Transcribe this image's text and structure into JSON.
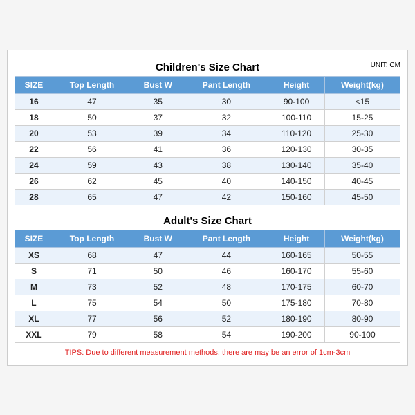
{
  "children_title": "Children's Size Chart",
  "adult_title": "Adult's Size Chart",
  "unit": "UNIT: CM",
  "headers": [
    "SIZE",
    "Top Length",
    "Bust W",
    "Pant Length",
    "Height",
    "Weight(kg)"
  ],
  "children_rows": [
    [
      "16",
      "47",
      "35",
      "30",
      "90-100",
      "<15"
    ],
    [
      "18",
      "50",
      "37",
      "32",
      "100-110",
      "15-25"
    ],
    [
      "20",
      "53",
      "39",
      "34",
      "110-120",
      "25-30"
    ],
    [
      "22",
      "56",
      "41",
      "36",
      "120-130",
      "30-35"
    ],
    [
      "24",
      "59",
      "43",
      "38",
      "130-140",
      "35-40"
    ],
    [
      "26",
      "62",
      "45",
      "40",
      "140-150",
      "40-45"
    ],
    [
      "28",
      "65",
      "47",
      "42",
      "150-160",
      "45-50"
    ]
  ],
  "adult_rows": [
    [
      "XS",
      "68",
      "47",
      "44",
      "160-165",
      "50-55"
    ],
    [
      "S",
      "71",
      "50",
      "46",
      "160-170",
      "55-60"
    ],
    [
      "M",
      "73",
      "52",
      "48",
      "170-175",
      "60-70"
    ],
    [
      "L",
      "75",
      "54",
      "50",
      "175-180",
      "70-80"
    ],
    [
      "XL",
      "77",
      "56",
      "52",
      "180-190",
      "80-90"
    ],
    [
      "XXL",
      "79",
      "58",
      "54",
      "190-200",
      "90-100"
    ]
  ],
  "tips": "TIPS: Due to different measurement methods, there are may be an error of 1cm-3cm"
}
